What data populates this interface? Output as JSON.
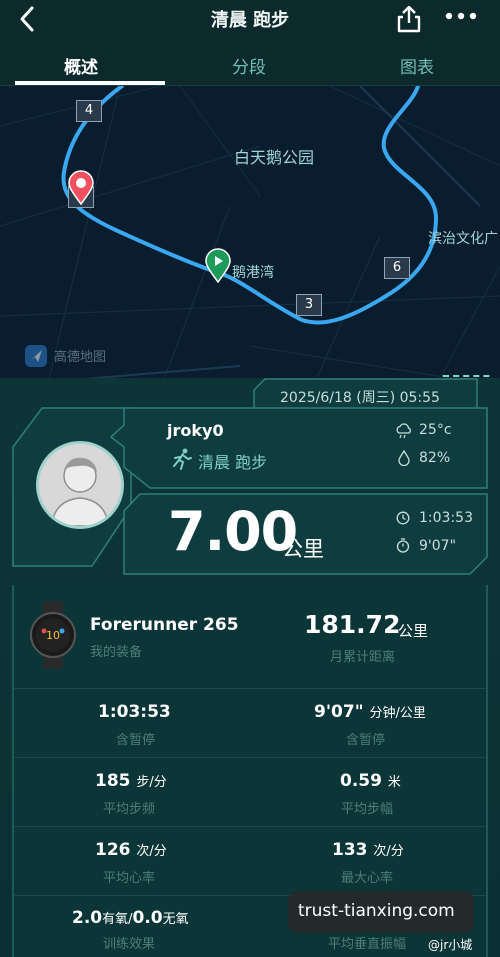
{
  "header": {
    "title": "清晨 跑步",
    "tabs": [
      {
        "label": "概述",
        "active": true
      },
      {
        "label": "分段",
        "active": false
      },
      {
        "label": "图表",
        "active": false
      }
    ]
  },
  "map": {
    "park_label": "白天鹅公园",
    "bay_label": "鹅港湾",
    "culture_label": "滨治文化广",
    "logo_text": "高德地图",
    "km_markers": [
      "4",
      "7",
      "6",
      "3"
    ],
    "add_button": "+",
    "route_color": "#3aa8f0"
  },
  "summary": {
    "datetime": "2025/6/18 (周三) 05:55",
    "username": "jroky0",
    "activity": "清晨 跑步",
    "temperature": "25°c",
    "humidity": "82%",
    "distance_value": "7.00",
    "distance_unit": "公里",
    "duration": "1:03:53",
    "pace": "9'07\""
  },
  "device": {
    "name": "Forerunner 265",
    "sub": "我的装备",
    "month_distance": "181.72",
    "month_unit": "公里",
    "month_label": "月累计距离"
  },
  "stats": [
    {
      "value": "1:03:53",
      "unit": "",
      "label": "含暂停"
    },
    {
      "value": "9'07\"",
      "unit": "分钟/公里",
      "label": "含暂停"
    },
    {
      "value": "185",
      "unit": "步/分",
      "label": "平均步频"
    },
    {
      "value": "0.59",
      "unit": "米",
      "label": "平均步幅"
    },
    {
      "value": "126",
      "unit": "次/分",
      "label": "平均心率"
    },
    {
      "value": "133",
      "unit": "次/分",
      "label": "最大心率"
    },
    {
      "value": "2.0",
      "unit": "有氧/",
      "value2": "0.0",
      "unit2": "无氧",
      "label": "训练效果"
    },
    {
      "value": "",
      "unit": "",
      "label": "平均垂直振幅"
    }
  ],
  "watermark": {
    "site": "trust-tianxing.com",
    "weibo": "@jr小城"
  },
  "colors": {
    "background": "#0b2a2c",
    "accent": "#7fd0c7",
    "route": "#3aa8f0"
  }
}
